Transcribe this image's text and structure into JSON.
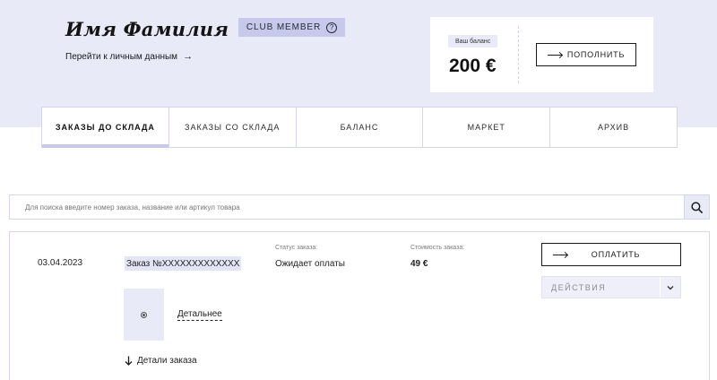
{
  "user": {
    "name": "Имя Фамилия",
    "profile_link": "Перейти к личным данным",
    "badge": "CLUB MEMBER",
    "badge_help": "?"
  },
  "balance": {
    "label": "Ваш баланс",
    "value": "200 €",
    "topup_label": "ПОПОЛНИТЬ"
  },
  "tabs": [
    {
      "label": "ЗАКАЗЫ ДО СКЛАДА",
      "active": true
    },
    {
      "label": "ЗАКАЗЫ СО СКЛАДА",
      "active": false
    },
    {
      "label": "БАЛАНС",
      "active": false
    },
    {
      "label": "МАРКЕТ",
      "active": false
    },
    {
      "label": "АРХИВ",
      "active": false
    }
  ],
  "search": {
    "placeholder": "Для поиска введите номер заказа, название или артикул товара",
    "value": ""
  },
  "order": {
    "date": "03.04.2023",
    "number": "Заказ №XXXXXXXXXXXXX",
    "status_label": "Статус заказа:",
    "status_value": "Ожидает оплаты",
    "cost_label": "Стоимость заказа:",
    "cost_value": "49 €",
    "pay_label": "ОПЛАТИТЬ",
    "actions_label": "ДЕЙСТВИЯ",
    "more_label": "Детальнее",
    "details_label": "Детали заказа"
  },
  "colors": {
    "hero_bg": "#e9eaf7",
    "accent": "#c7c9ea",
    "border": "#d4d6ef"
  },
  "icons": [
    "arrow-right-icon",
    "help-circle-icon",
    "long-arrow-right-icon",
    "search-icon",
    "chevron-down-icon",
    "image-placeholder-icon",
    "arrow-down-icon"
  ]
}
